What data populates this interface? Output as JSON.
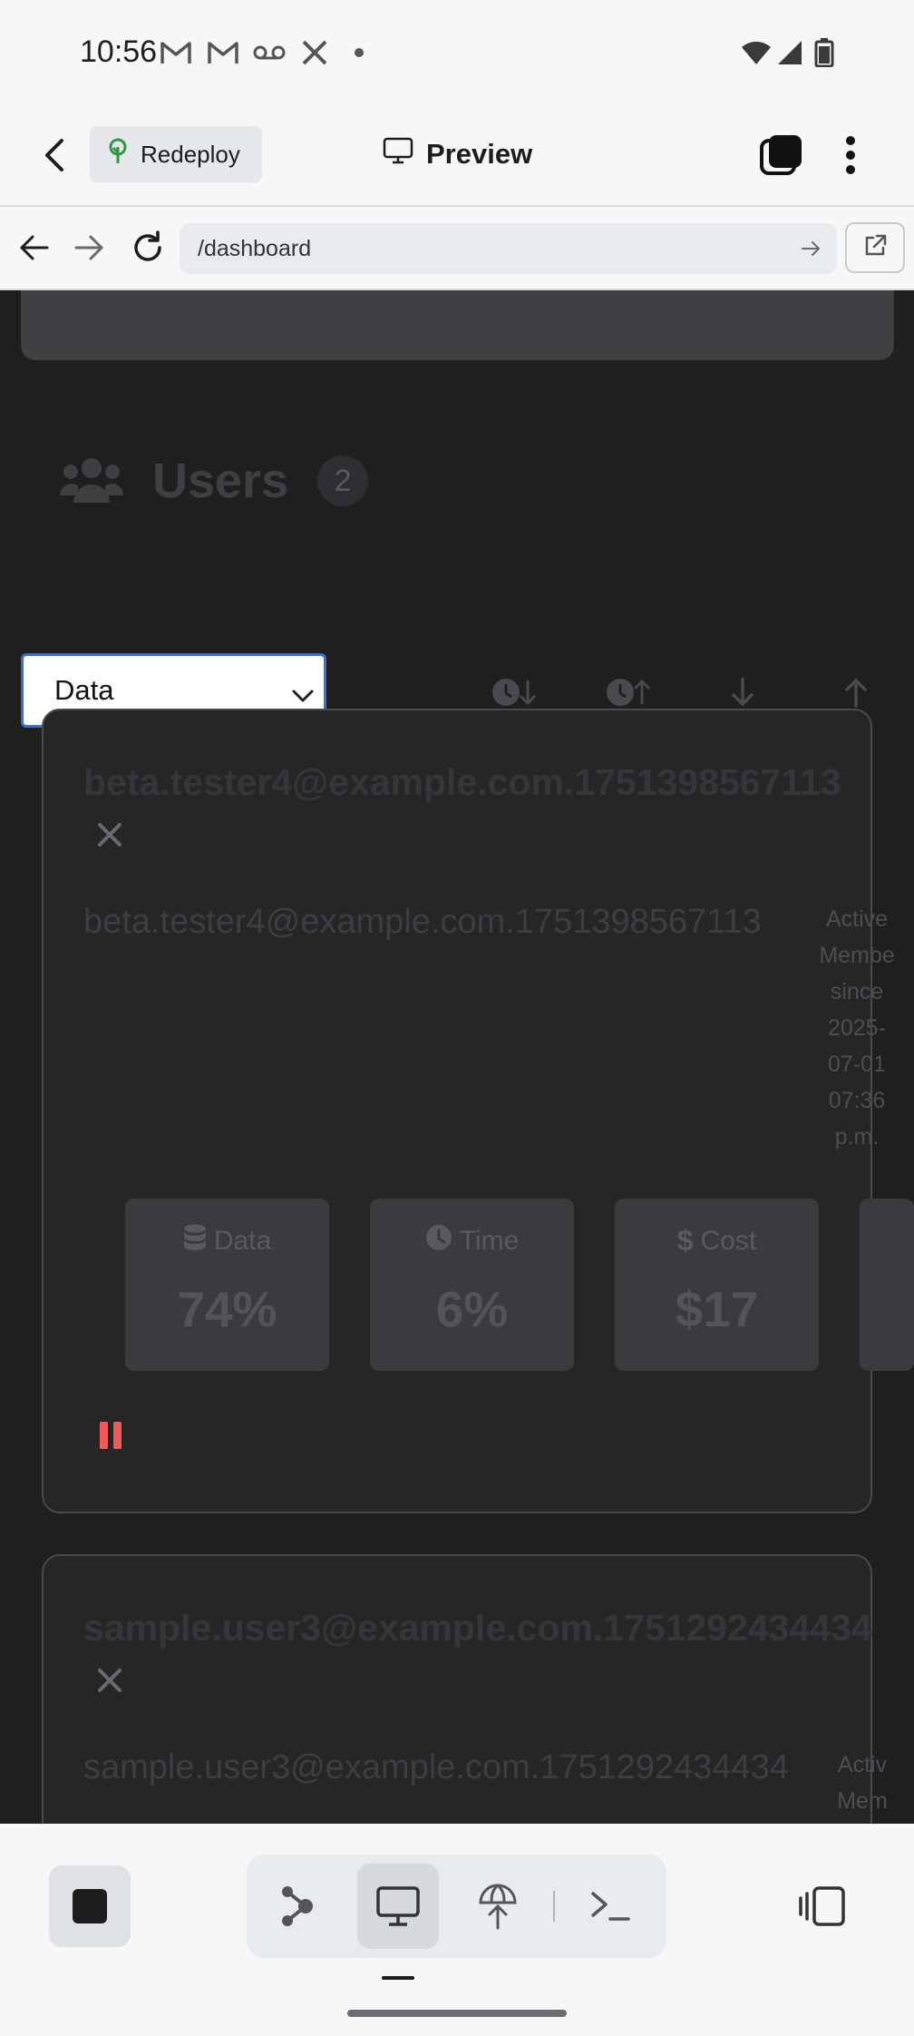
{
  "status_bar": {
    "time": "10:56",
    "notification_icons": [
      "gmail-icon",
      "gmail-icon",
      "voicemail-icon",
      "x-icon",
      "dot-icon"
    ],
    "system_icons": [
      "wifi-icon",
      "signal-icon",
      "battery-icon"
    ]
  },
  "app_header": {
    "back_icon": "arrow-left-icon",
    "redeploy_label": "Redeploy",
    "preview_label": "Preview",
    "tabs_icon": "tabs-icon",
    "more_icon": "more-vertical-icon"
  },
  "url_bar": {
    "url": "/dashboard"
  },
  "users_section": {
    "title": "Users",
    "count": "2",
    "sort_selected": "Data",
    "sort_buttons": [
      "clock-sort-down-icon",
      "clock-sort-up-icon",
      "arrow-down-icon",
      "arrow-up-icon"
    ]
  },
  "user_cards": [
    {
      "email_heading": "beta.tester4@example.com.1751398567113",
      "email": "beta.tester4@example.com.1751398567113",
      "meta": [
        "Active",
        "Membe",
        "since",
        "2025-",
        "07-01",
        "07:36",
        "p.m."
      ],
      "stats": [
        {
          "icon": "database-icon",
          "label": "Data",
          "value": "74%"
        },
        {
          "icon": "clock-icon",
          "label": "Time",
          "value": "6%"
        },
        {
          "icon": "dollar-icon",
          "label": "Cost",
          "value": "$17"
        }
      ],
      "pause_color": "#f05a5a"
    },
    {
      "email_heading": "sample.user3@example.com.1751292434434",
      "email": "sample.user3@example.com.1751292434434",
      "meta": [
        "Activ",
        "Mem"
      ]
    }
  ],
  "bottom_bar": {
    "stop_icon": "stop-icon",
    "tools": [
      "graph-icon",
      "desktop-preview-icon",
      "deploy-icon",
      "terminal-icon"
    ],
    "active_tool": "desktop-preview-icon",
    "split_icon": "split-view-icon"
  }
}
